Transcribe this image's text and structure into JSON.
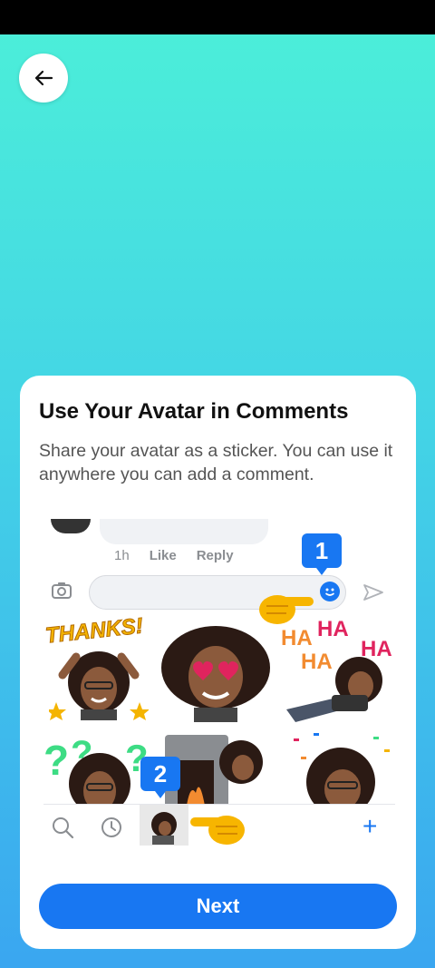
{
  "header": {
    "back_icon": "arrow-left-icon"
  },
  "card": {
    "title": "Use Your Avatar in Comments",
    "subtitle": "Share your avatar as a sticker. You can use it anywhere you can add a comment."
  },
  "demo": {
    "meta": {
      "time": "1h",
      "like": "Like",
      "reply": "Reply"
    },
    "badge_1": "1",
    "badge_2": "2",
    "stickers": {
      "thanks": "THANKS!",
      "ha1": "HA",
      "ha2": "HA",
      "ha3": "HA",
      "ha4": "HA"
    },
    "tray_plus": "+"
  },
  "footer": {
    "next_label": "Next"
  },
  "colors": {
    "accent": "#1877f2",
    "bg_top": "#4cf0d8",
    "bg_bottom": "#3aa6f0"
  }
}
